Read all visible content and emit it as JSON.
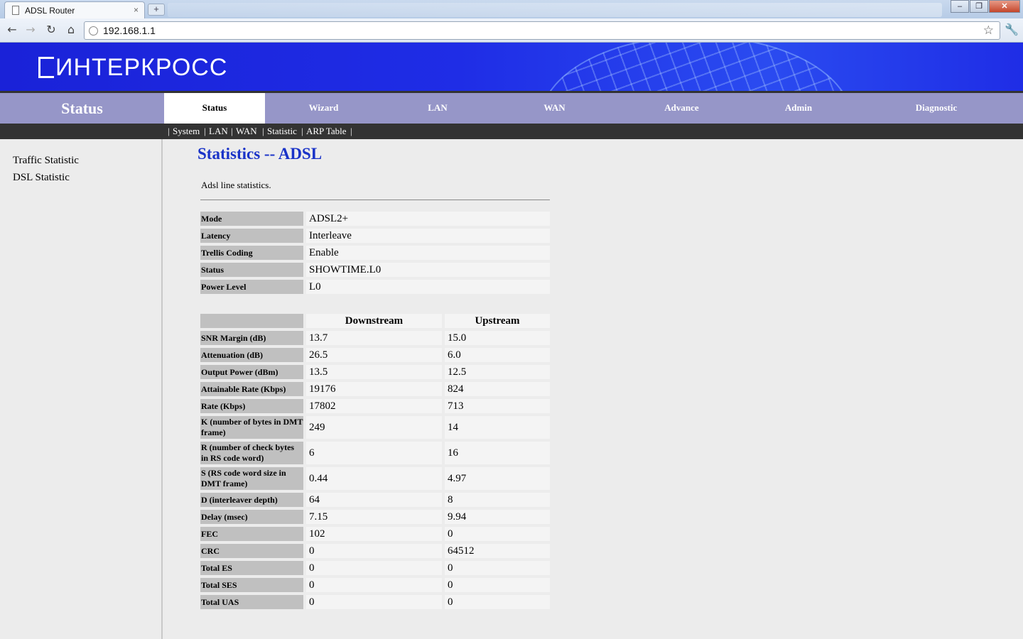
{
  "browser": {
    "tab_title": "ADSL Router",
    "tab_close": "×",
    "new_tab": "+",
    "url": "192.168.1.1",
    "window_buttons": [
      "–",
      "❐",
      "✕"
    ]
  },
  "header": {
    "logo_text": "ИНТЕРКРОСС",
    "section_title": "Status",
    "nav": [
      "Status",
      "Wizard",
      "LAN",
      "WAN",
      "Advance",
      "Admin",
      "Diagnostic"
    ],
    "active_nav": "Status",
    "subnav": [
      "System",
      "LAN",
      "WAN",
      "Statistic",
      "ARP Table"
    ]
  },
  "sidebar": {
    "items": [
      "Traffic Statistic",
      "DSL Statistic"
    ]
  },
  "main": {
    "title": "Statistics -- ADSL",
    "description": "Adsl line statistics.",
    "line_info": [
      {
        "label": "Mode",
        "value": "ADSL2+"
      },
      {
        "label": "Latency",
        "value": "Interleave"
      },
      {
        "label": "Trellis Coding",
        "value": "Enable"
      },
      {
        "label": "Status",
        "value": "SHOWTIME.L0"
      },
      {
        "label": "Power Level",
        "value": "L0"
      }
    ],
    "stats_headers": [
      "Downstream",
      "Upstream"
    ],
    "stats": [
      {
        "label": "SNR Margin (dB)",
        "down": "13.7",
        "up": "15.0"
      },
      {
        "label": "Attenuation (dB)",
        "down": "26.5",
        "up": "6.0"
      },
      {
        "label": "Output Power (dBm)",
        "down": "13.5",
        "up": "12.5"
      },
      {
        "label": "Attainable Rate (Kbps)",
        "down": "19176",
        "up": "824"
      },
      {
        "label": "Rate (Kbps)",
        "down": "17802",
        "up": "713"
      },
      {
        "label": "K (number of bytes in DMT frame)",
        "down": "249",
        "up": "14"
      },
      {
        "label": "R (number of check bytes in RS code word)",
        "down": "6",
        "up": "16"
      },
      {
        "label": "S (RS code word size in DMT frame)",
        "down": "0.44",
        "up": "4.97"
      },
      {
        "label": "D (interleaver depth)",
        "down": "64",
        "up": "8"
      },
      {
        "label": "Delay (msec)",
        "down": "7.15",
        "up": "9.94"
      },
      {
        "label": "FEC",
        "down": "102",
        "up": "0"
      },
      {
        "label": "CRC",
        "down": "0",
        "up": "64512"
      },
      {
        "label": "Total ES",
        "down": "0",
        "up": "0"
      },
      {
        "label": "Total SES",
        "down": "0",
        "up": "0"
      },
      {
        "label": "Total UAS",
        "down": "0",
        "up": "0"
      }
    ]
  },
  "colors": {
    "banner": "#1f2de6",
    "nav_bar": "#9696c8",
    "title": "#1a33c8",
    "label_cell": "#c0c0c0"
  }
}
